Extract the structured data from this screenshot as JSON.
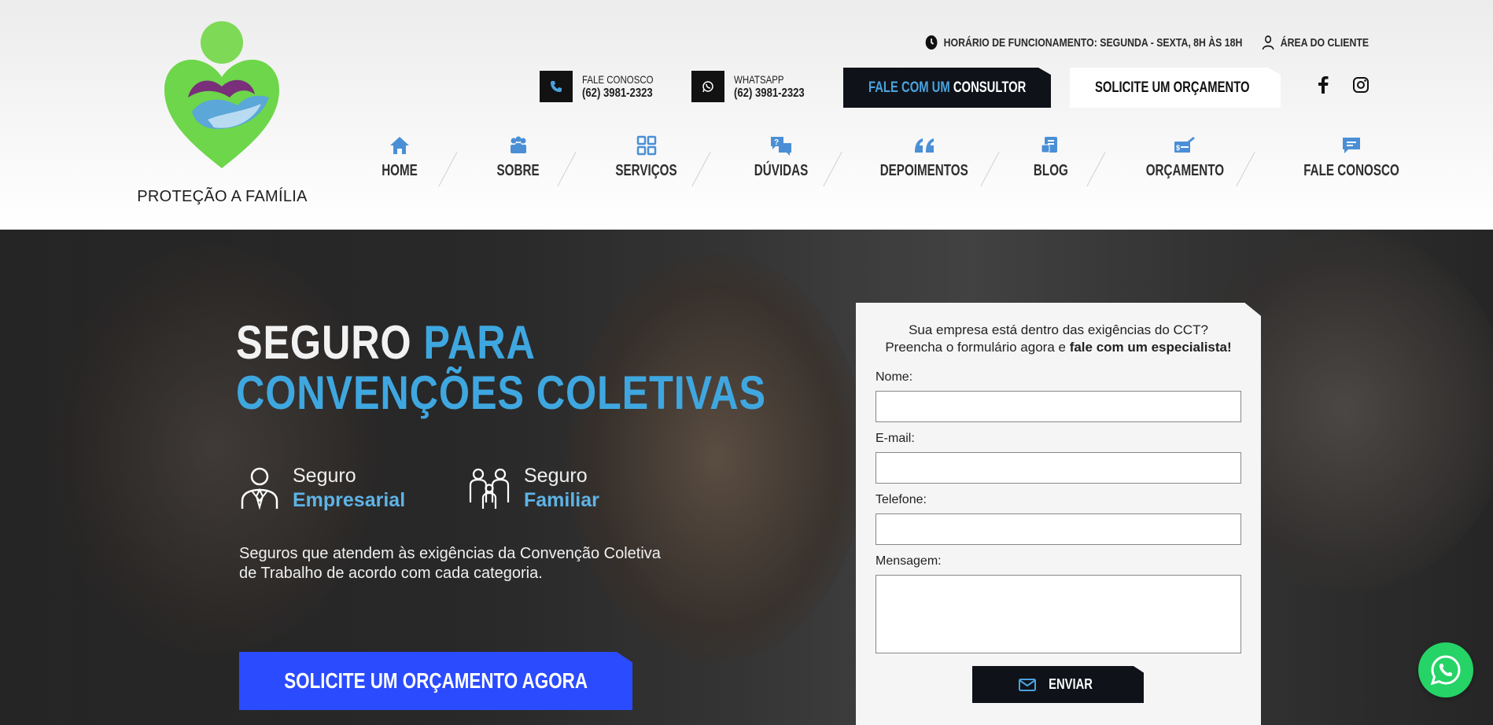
{
  "brand": {
    "name": "PROTEÇÃO A FAMÍLIA"
  },
  "topbar": {
    "hours": "HORÁRIO DE FUNCIONAMENTO: SEGUNDA - SEXTA, 8H ÀS 18H",
    "client_area": "ÁREA DO CLIENTE"
  },
  "contacts": {
    "phone_label": "FALE CONOSCO",
    "phone_number": "(62) 3981-2323",
    "whatsapp_label": "WHATSAPP",
    "whatsapp_number": "(62) 3981-2323"
  },
  "buttons": {
    "consult_prefix": "FALE COM UM",
    "consult_suffix": "CONSULTOR",
    "quote": "SOLICITE UM ORÇAMENTO"
  },
  "nav": [
    {
      "label": "HOME",
      "icon": "home-icon"
    },
    {
      "label": "SOBRE",
      "icon": "people-icon"
    },
    {
      "label": "SERVIÇOS",
      "icon": "grid-icon"
    },
    {
      "label": "DÚVIDAS",
      "icon": "question-chat-icon"
    },
    {
      "label": "DEPOIMENTOS",
      "icon": "quote-icon"
    },
    {
      "label": "BLOG",
      "icon": "blog-icon"
    },
    {
      "label": "ORÇAMENTO",
      "icon": "budget-icon"
    },
    {
      "label": "FALE CONOSCO",
      "icon": "message-icon"
    }
  ],
  "hero": {
    "title_white": "SEGURO",
    "title_blue_1": "PARA",
    "title_blue_2": "CONVENÇÕES COLETIVAS",
    "seg1_top": "Seguro",
    "seg1_bottom": "Empresarial",
    "seg2_top": "Seguro",
    "seg2_bottom": "Familiar",
    "description": "Seguros que atendem às exigências da Convenção Coletiva de Trabalho de acordo com cada categoria.",
    "cta": "SOLICITE UM ORÇAMENTO AGORA"
  },
  "form": {
    "intro_line1": "Sua empresa está dentro das exigências do CCT?",
    "intro_line2_plain": "Preencha o formulário agora e ",
    "intro_line2_bold": "fale com um especialista!",
    "name_label": "Nome:",
    "email_label": "E-mail:",
    "phone_label": "Telefone:",
    "message_label": "Mensagem:",
    "name_value": "",
    "email_value": "",
    "phone_value": "",
    "message_value": "",
    "submit": "ENVIAR"
  },
  "colors": {
    "accent_blue": "#3fa7e0",
    "cta_blue": "#2b4bff",
    "dark": "#0f1319",
    "whatsapp_green": "#25d366"
  }
}
